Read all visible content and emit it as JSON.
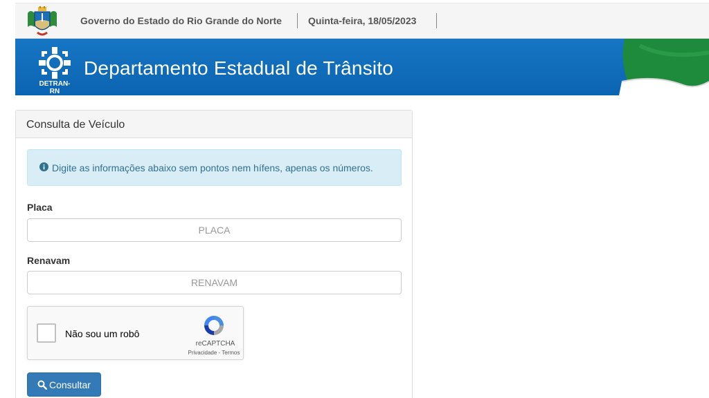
{
  "header": {
    "government": "Governo do Estado do Rio Grande do Norte",
    "date": "Quinta-feira, 18/05/2023"
  },
  "banner": {
    "logo_label": "DETRAN-RN",
    "title": "Departamento Estadual de Trânsito"
  },
  "form": {
    "panel_title": "Consulta de Veículo",
    "info_message": "Digite as informações abaixo sem pontos nem hífens, apenas os números.",
    "placa_label": "Placa",
    "placa_placeholder": "PLACA",
    "placa_value": "",
    "renavam_label": "Renavam",
    "renavam_placeholder": "RENAVAM",
    "renavam_value": "",
    "submit_label": "Consultar"
  },
  "recaptcha": {
    "label": "Não sou um robô",
    "brand": "reCAPTCHA",
    "terms": "Privacidade - Termos"
  },
  "icons": {
    "info": "info-circle-icon",
    "search": "search-icon"
  },
  "colors": {
    "banner_blue": "#0b64b1",
    "primary_button": "#337ab7",
    "alert_bg": "#d9edf7",
    "alert_text": "#31708f"
  }
}
